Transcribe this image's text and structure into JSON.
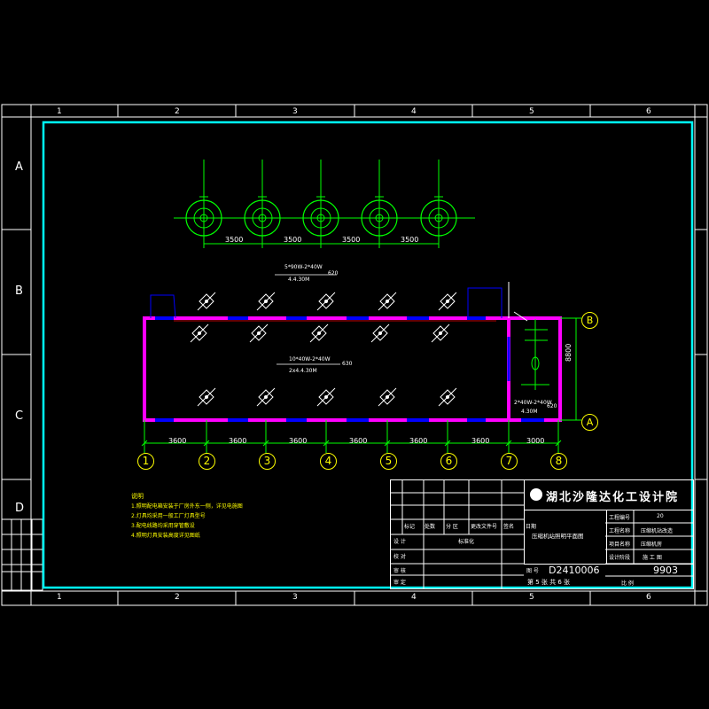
{
  "sheet": {
    "col_labels": [
      "1",
      "2",
      "3",
      "4",
      "5",
      "6"
    ],
    "row_labels": [
      "A",
      "B",
      "C",
      "D"
    ]
  },
  "fixtures_top": {
    "dims": [
      "3500",
      "3500",
      "3500",
      "3500"
    ]
  },
  "plan": {
    "axis_numbers": [
      "1",
      "2",
      "3",
      "4",
      "5",
      "6",
      "7",
      "8"
    ],
    "axis_letters": [
      "B",
      "A"
    ],
    "dims": [
      "3600",
      "3600",
      "3600",
      "3600",
      "3600",
      "3600",
      "3000"
    ],
    "depth_dim": "8800",
    "top_label": {
      "line1": "5*90W-2*40W",
      "line2": "4.4.30M",
      "suffix": "620"
    },
    "mid_label": {
      "line1": "10*40W-2*40W",
      "line2": "2x4.4.30M",
      "suffix": "630"
    },
    "small_room_label": {
      "line1": "2*40W-2*40W",
      "line2": "4.30M",
      "suffix": "620"
    }
  },
  "notes": {
    "title": "说明",
    "items": [
      "1.照明配电箱安装于厂房外东一侧，详见电施图",
      "2.灯具均采用一般工厂灯具型号",
      "3.配电线路均采用穿管敷设",
      "4.照明灯具安装高度详见图纸"
    ]
  },
  "titleblock": {
    "company": "湖北沙隆达化工设计院",
    "drawing_title": "压缩机站照明平面图",
    "row_labels": [
      "标记",
      "处数",
      "分 区",
      "更改文件号",
      "签名",
      "日期"
    ],
    "left_labels": [
      "设 计",
      "校 对",
      "审 核",
      "审 定"
    ],
    "standard_label": "标准化",
    "right_keys": [
      "工程编号",
      "工程名称",
      "项目名称",
      "设计阶段"
    ],
    "right_vals": [
      "20",
      "压缩机站改造",
      "压缩机房",
      "施 工 图"
    ],
    "drawing_no_label": "图 号",
    "drawing_no": "D2410006",
    "date_val": "9903",
    "sheet_text": "第 5 张   共 6 张",
    "ratio_label": "比 例"
  },
  "colors": {
    "frame": "#ffffff",
    "inner_border": "#00ffff",
    "wall": "#ff00ff",
    "window": "#0000ff",
    "fixture": "#00ff00",
    "axis_bubble": "#ffff00",
    "text": "#ffffff"
  }
}
